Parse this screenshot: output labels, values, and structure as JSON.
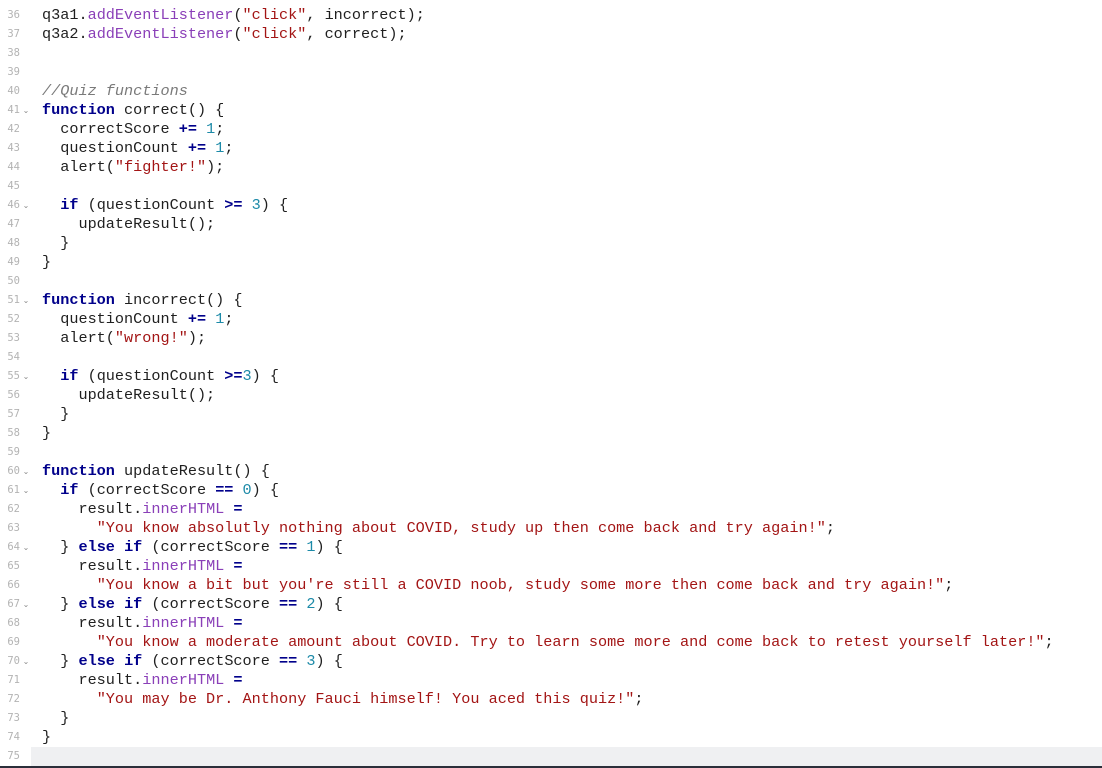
{
  "editor": {
    "fold_glyph": "⌄",
    "lines": [
      {
        "n": "36",
        "fold": false,
        "tokens": [
          {
            "t": "q3a1."
          },
          {
            "t": "addEventListener",
            "c": "prop"
          },
          {
            "t": "("
          },
          {
            "t": "\"click\"",
            "c": "str"
          },
          {
            "t": ", incorrect);"
          }
        ]
      },
      {
        "n": "37",
        "fold": false,
        "tokens": [
          {
            "t": "q3a2."
          },
          {
            "t": "addEventListener",
            "c": "prop"
          },
          {
            "t": "("
          },
          {
            "t": "\"click\"",
            "c": "str"
          },
          {
            "t": ", correct);"
          }
        ]
      },
      {
        "n": "38",
        "fold": false,
        "tokens": []
      },
      {
        "n": "39",
        "fold": false,
        "tokens": []
      },
      {
        "n": "40",
        "fold": false,
        "tokens": [
          {
            "t": "//Quiz functions",
            "c": "cm"
          }
        ]
      },
      {
        "n": "41",
        "fold": true,
        "tokens": [
          {
            "t": "function",
            "c": "kw"
          },
          {
            "t": " correct() {"
          }
        ]
      },
      {
        "n": "42",
        "fold": false,
        "tokens": [
          {
            "t": "  correctScore "
          },
          {
            "t": "+=",
            "c": "kw"
          },
          {
            "t": " "
          },
          {
            "t": "1",
            "c": "num"
          },
          {
            "t": ";"
          }
        ]
      },
      {
        "n": "43",
        "fold": false,
        "tokens": [
          {
            "t": "  questionCount "
          },
          {
            "t": "+=",
            "c": "kw"
          },
          {
            "t": " "
          },
          {
            "t": "1",
            "c": "num"
          },
          {
            "t": ";"
          }
        ]
      },
      {
        "n": "44",
        "fold": false,
        "tokens": [
          {
            "t": "  alert("
          },
          {
            "t": "\"fighter!\"",
            "c": "str"
          },
          {
            "t": ");"
          }
        ]
      },
      {
        "n": "45",
        "fold": false,
        "tokens": []
      },
      {
        "n": "46",
        "fold": true,
        "tokens": [
          {
            "t": "  "
          },
          {
            "t": "if",
            "c": "kw"
          },
          {
            "t": " (questionCount "
          },
          {
            "t": ">=",
            "c": "kw"
          },
          {
            "t": " "
          },
          {
            "t": "3",
            "c": "num"
          },
          {
            "t": ") {"
          }
        ]
      },
      {
        "n": "47",
        "fold": false,
        "tokens": [
          {
            "t": "    updateResult();"
          }
        ]
      },
      {
        "n": "48",
        "fold": false,
        "tokens": [
          {
            "t": "  }"
          }
        ]
      },
      {
        "n": "49",
        "fold": false,
        "tokens": [
          {
            "t": "}"
          }
        ]
      },
      {
        "n": "50",
        "fold": false,
        "tokens": []
      },
      {
        "n": "51",
        "fold": true,
        "tokens": [
          {
            "t": "function",
            "c": "kw"
          },
          {
            "t": " incorrect() {"
          }
        ]
      },
      {
        "n": "52",
        "fold": false,
        "tokens": [
          {
            "t": "  questionCount "
          },
          {
            "t": "+=",
            "c": "kw"
          },
          {
            "t": " "
          },
          {
            "t": "1",
            "c": "num"
          },
          {
            "t": ";"
          }
        ]
      },
      {
        "n": "53",
        "fold": false,
        "tokens": [
          {
            "t": "  alert("
          },
          {
            "t": "\"wrong!\"",
            "c": "str"
          },
          {
            "t": ");"
          }
        ]
      },
      {
        "n": "54",
        "fold": false,
        "tokens": []
      },
      {
        "n": "55",
        "fold": true,
        "tokens": [
          {
            "t": "  "
          },
          {
            "t": "if",
            "c": "kw"
          },
          {
            "t": " (questionCount "
          },
          {
            "t": ">=",
            "c": "kw"
          },
          {
            "t": "3",
            "c": "num"
          },
          {
            "t": ") {"
          }
        ]
      },
      {
        "n": "56",
        "fold": false,
        "tokens": [
          {
            "t": "    updateResult();"
          }
        ]
      },
      {
        "n": "57",
        "fold": false,
        "tokens": [
          {
            "t": "  }"
          }
        ]
      },
      {
        "n": "58",
        "fold": false,
        "tokens": [
          {
            "t": "}"
          }
        ]
      },
      {
        "n": "59",
        "fold": false,
        "tokens": []
      },
      {
        "n": "60",
        "fold": true,
        "tokens": [
          {
            "t": "function",
            "c": "kw"
          },
          {
            "t": " updateResult() {"
          }
        ]
      },
      {
        "n": "61",
        "fold": true,
        "tokens": [
          {
            "t": "  "
          },
          {
            "t": "if",
            "c": "kw"
          },
          {
            "t": " (correctScore "
          },
          {
            "t": "==",
            "c": "kw"
          },
          {
            "t": " "
          },
          {
            "t": "0",
            "c": "num"
          },
          {
            "t": ") {"
          }
        ]
      },
      {
        "n": "62",
        "fold": false,
        "tokens": [
          {
            "t": "    result."
          },
          {
            "t": "innerHTML",
            "c": "prop"
          },
          {
            "t": " "
          },
          {
            "t": "=",
            "c": "kw"
          }
        ]
      },
      {
        "n": "63",
        "fold": false,
        "tokens": [
          {
            "t": "      "
          },
          {
            "t": "\"You know absolutly nothing about COVID, study up then come back and try again!\"",
            "c": "str"
          },
          {
            "t": ";"
          }
        ]
      },
      {
        "n": "64",
        "fold": true,
        "tokens": [
          {
            "t": "  } "
          },
          {
            "t": "else",
            "c": "kw"
          },
          {
            "t": " "
          },
          {
            "t": "if",
            "c": "kw"
          },
          {
            "t": " (correctScore "
          },
          {
            "t": "==",
            "c": "kw"
          },
          {
            "t": " "
          },
          {
            "t": "1",
            "c": "num"
          },
          {
            "t": ") {"
          }
        ]
      },
      {
        "n": "65",
        "fold": false,
        "tokens": [
          {
            "t": "    result."
          },
          {
            "t": "innerHTML",
            "c": "prop"
          },
          {
            "t": " "
          },
          {
            "t": "=",
            "c": "kw"
          }
        ]
      },
      {
        "n": "66",
        "fold": false,
        "tokens": [
          {
            "t": "      "
          },
          {
            "t": "\"You know a bit but you're still a COVID noob, study some more then come back and try again!\"",
            "c": "str"
          },
          {
            "t": ";"
          }
        ]
      },
      {
        "n": "67",
        "fold": true,
        "tokens": [
          {
            "t": "  } "
          },
          {
            "t": "else",
            "c": "kw"
          },
          {
            "t": " "
          },
          {
            "t": "if",
            "c": "kw"
          },
          {
            "t": " (correctScore "
          },
          {
            "t": "==",
            "c": "kw"
          },
          {
            "t": " "
          },
          {
            "t": "2",
            "c": "num"
          },
          {
            "t": ") {"
          }
        ]
      },
      {
        "n": "68",
        "fold": false,
        "tokens": [
          {
            "t": "    result."
          },
          {
            "t": "innerHTML",
            "c": "prop"
          },
          {
            "t": " "
          },
          {
            "t": "=",
            "c": "kw"
          }
        ]
      },
      {
        "n": "69",
        "fold": false,
        "tokens": [
          {
            "t": "      "
          },
          {
            "t": "\"You know a moderate amount about COVID. Try to learn some more and come back to retest yourself later!\"",
            "c": "str"
          },
          {
            "t": ";"
          }
        ]
      },
      {
        "n": "70",
        "fold": true,
        "tokens": [
          {
            "t": "  } "
          },
          {
            "t": "else",
            "c": "kw"
          },
          {
            "t": " "
          },
          {
            "t": "if",
            "c": "kw"
          },
          {
            "t": " (correctScore "
          },
          {
            "t": "==",
            "c": "kw"
          },
          {
            "t": " "
          },
          {
            "t": "3",
            "c": "num"
          },
          {
            "t": ") {"
          }
        ]
      },
      {
        "n": "71",
        "fold": false,
        "tokens": [
          {
            "t": "    result."
          },
          {
            "t": "innerHTML",
            "c": "prop"
          },
          {
            "t": " "
          },
          {
            "t": "=",
            "c": "kw"
          }
        ]
      },
      {
        "n": "72",
        "fold": false,
        "tokens": [
          {
            "t": "      "
          },
          {
            "t": "\"You may be Dr. Anthony Fauci himself! You aced this quiz!\"",
            "c": "str"
          },
          {
            "t": ";"
          }
        ]
      },
      {
        "n": "73",
        "fold": false,
        "tokens": [
          {
            "t": "  }"
          }
        ]
      },
      {
        "n": "74",
        "fold": false,
        "tokens": [
          {
            "t": "}"
          }
        ]
      },
      {
        "n": "75",
        "fold": false,
        "active": true,
        "tokens": []
      }
    ]
  },
  "colors": {
    "keyword": "#00008b",
    "string": "#a31515",
    "number": "#1c8aa8",
    "property": "#8a3fb8",
    "comment": "#7a7a7a",
    "active_line": "#eff0f2"
  }
}
